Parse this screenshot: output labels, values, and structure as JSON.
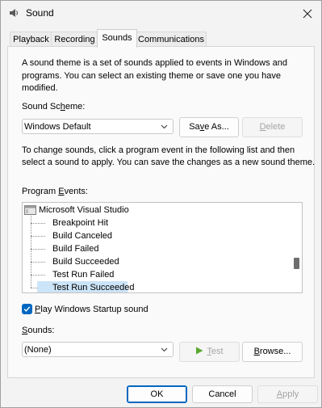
{
  "window": {
    "title": "Sound"
  },
  "tabs": [
    {
      "label": "Playback",
      "active": false
    },
    {
      "label": "Recording",
      "active": false
    },
    {
      "label": "Sounds",
      "active": true
    },
    {
      "label": "Communications",
      "active": false
    }
  ],
  "sounds_tab": {
    "description_line1": "A sound theme is a set of sounds applied to events in Windows and",
    "description_line2": "programs.  You can select an existing theme or save one you have",
    "description_line3": "modified.",
    "scheme_label_pre": "Sound Sc",
    "scheme_label_ul": "h",
    "scheme_label_post": "eme:",
    "scheme_value": "Windows Default",
    "save_as_pre": "Sa",
    "save_as_ul": "v",
    "save_as_post": "e As...",
    "delete_pre": "",
    "delete_ul": "D",
    "delete_post": "elete",
    "instructions_line1": "To change sounds, click a program event in the following list and then",
    "instructions_line2": "select a sound to apply.  You can save the changes as a new sound theme.",
    "events_label_pre": "Program ",
    "events_label_ul": "E",
    "events_label_post": "vents:",
    "program_events": {
      "group": "Microsoft Visual Studio",
      "items": [
        {
          "label": "Breakpoint Hit"
        },
        {
          "label": "Build Canceled"
        },
        {
          "label": "Build Failed"
        },
        {
          "label": "Build Succeeded"
        },
        {
          "label": "Test Run Failed"
        },
        {
          "label": "Test Run Succeeded"
        }
      ],
      "selected_index": 5,
      "scroll_position_fraction": 0.72
    },
    "startup_checkbox_pre": "",
    "startup_checkbox_ul": "P",
    "startup_checkbox_post": "lay Windows Startup sound",
    "startup_checked": true,
    "sounds_label_pre": "",
    "sounds_label_ul": "S",
    "sounds_label_post": "ounds:",
    "sound_value": "(None)",
    "test_pre": "",
    "test_ul": "T",
    "test_post": "est",
    "browse_pre": "",
    "browse_ul": "B",
    "browse_post": "rowse..."
  },
  "footer": {
    "ok": "OK",
    "cancel": "Cancel",
    "apply_pre": "",
    "apply_ul": "A",
    "apply_post": "pply"
  },
  "colors": {
    "accent": "#0067c0",
    "selection": "#cce4f7",
    "disabled_text": "#a5a5a5",
    "play_icon": "#5aa832"
  },
  "icons": {
    "app": "speaker-icon",
    "close": "close-icon",
    "group": "application-icon",
    "play": "play-icon",
    "dropdown": "chevron-down-icon"
  }
}
